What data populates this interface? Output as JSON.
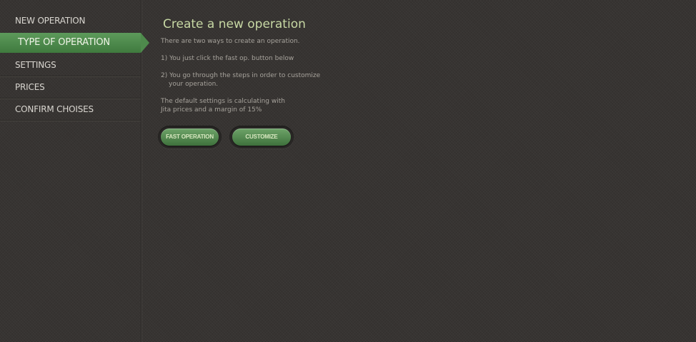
{
  "sidebar": {
    "items": [
      {
        "label": "NEW OPERATION"
      },
      {
        "label": "TYPE OF OPERATION"
      },
      {
        "label": "SETTINGS"
      },
      {
        "label": "PRICES"
      },
      {
        "label": "CONFIRM CHOISES"
      }
    ]
  },
  "main": {
    "title": "Create a new operation",
    "intro": "There are two ways to create an operation.",
    "option1": "1) You just click the fast op. button below",
    "option2_line1": "2) You go through the steps in order to customize",
    "option2_line2": "your operation.",
    "defaults_line1": "The default settings is calculating with",
    "defaults_line2": "Jita prices and a margin of 15%"
  },
  "buttons": {
    "fast_label": "FAST OPERATION",
    "customize_label": "CUSTOMIZE"
  },
  "colors": {
    "accent": "#4e8a4c",
    "title": "#c7d8a4",
    "background": "#373432"
  }
}
